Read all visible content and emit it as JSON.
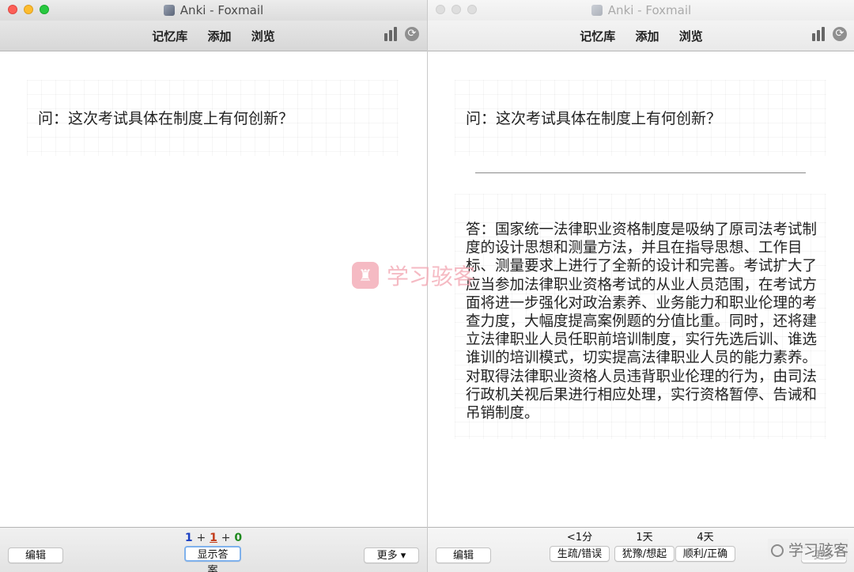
{
  "left_window": {
    "title": "Anki - Foxmail",
    "toolbar": {
      "decks": "记忆库",
      "add": "添加",
      "browse": "浏览"
    },
    "question": "问：这次考试具体在制度上有何创新？",
    "counts": {
      "new": "1",
      "plus1": "+",
      "learning": "1",
      "plus2": "+",
      "review": "0"
    },
    "edit_label": "编辑",
    "show_answer_label": "显示答案",
    "more_label": "更多 ▾"
  },
  "right_window": {
    "title": "Anki - Foxmail",
    "toolbar": {
      "decks": "记忆库",
      "add": "添加",
      "browse": "浏览"
    },
    "question": "问：这次考试具体在制度上有何创新？",
    "answer": "答：国家统一法律职业资格制度是吸纳了原司法考试制度的设计思想和测量方法，并且在指导思想、工作目标、测量要求上进行了全新的设计和完善。考试扩大了应当参加法律职业资格考试的从业人员范围，在考试方面将进一步强化对政治素养、业务能力和职业伦理的考查力度，大幅度提高案例题的分值比重。同时，还将建立法律职业人员任职前培训制度，实行先选后训、谁选谁训的培训模式，切实提高法律职业人员的能力素养。对取得法律职业资格人员违背职业伦理的行为，由司法行政机关视后果进行相应处理，实行资格暂停、告诫和吊销制度。",
    "edit_label": "编辑",
    "ease_buttons": [
      {
        "interval": "<1分",
        "label": "生疏/错误"
      },
      {
        "interval": "1天",
        "label": "犹豫/想起"
      },
      {
        "interval": "4天",
        "label": "顺利/正确"
      }
    ],
    "more_label": "更多"
  },
  "watermark": {
    "text": "学习骇客",
    "bottom_text": "学习骇客"
  },
  "icons": {
    "stats": "stats-icon",
    "sync": "sync-icon",
    "app": "anki-app-icon"
  },
  "colors": {
    "new_count": "#1a3fc2",
    "learning_count": "#c23b1a",
    "review_count": "#1f8a1f",
    "focus_ring": "#7fb1ec"
  }
}
